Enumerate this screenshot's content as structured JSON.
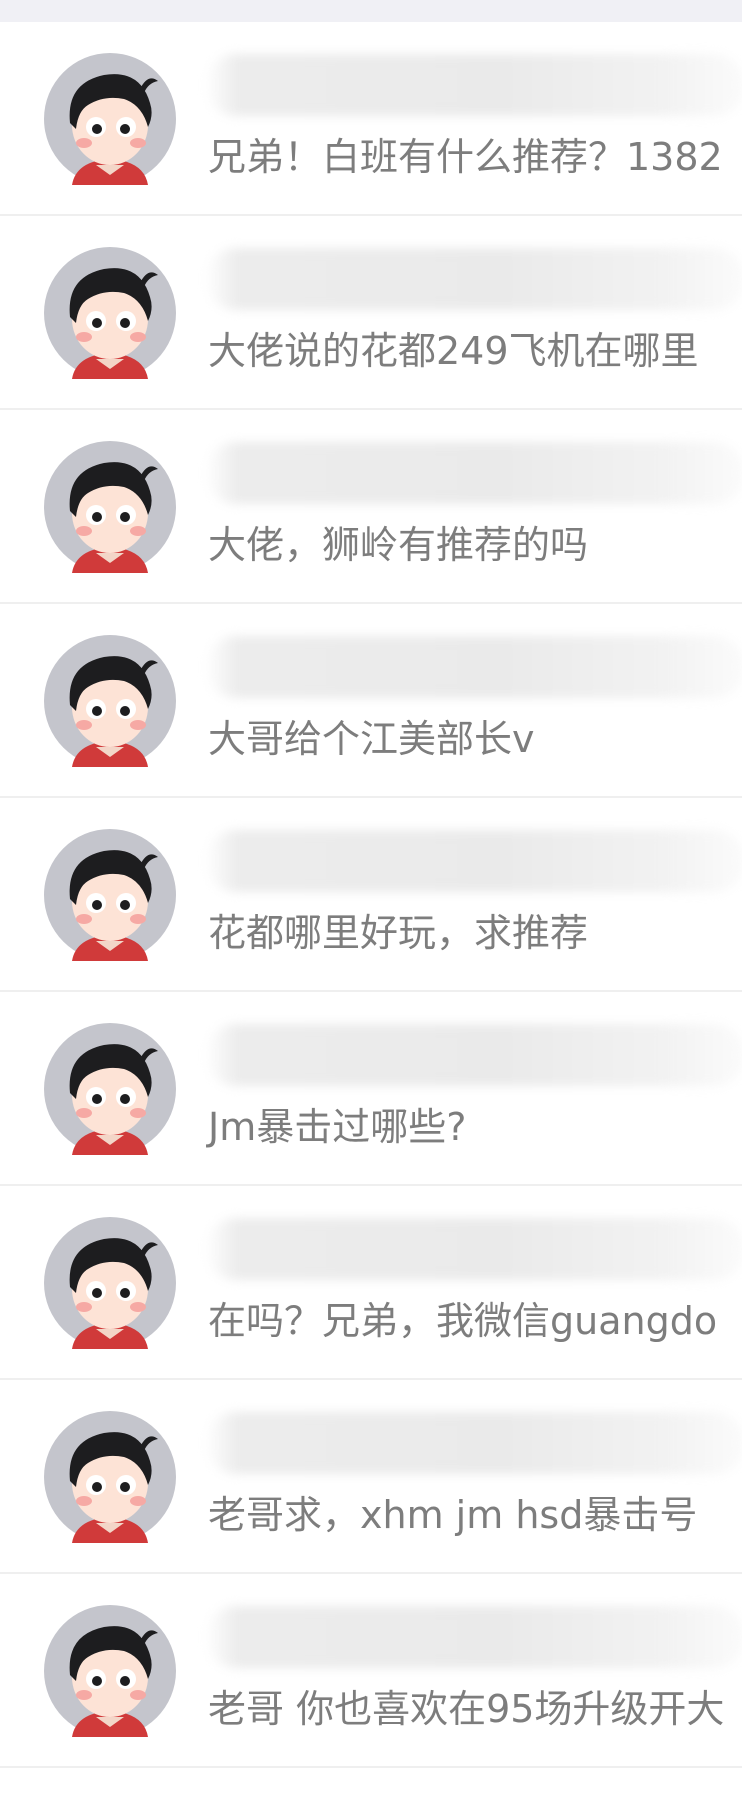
{
  "conversations": [
    {
      "preview": "兄弟！白班有什么推荐？1382"
    },
    {
      "preview": "大佬说的花都249飞机在哪里"
    },
    {
      "preview": "大佬，狮岭有推荐的吗"
    },
    {
      "preview": "大哥给个江美部长v"
    },
    {
      "preview": "花都哪里好玩，求推荐"
    },
    {
      "preview": "Jm暴击过哪些?"
    },
    {
      "preview": "在吗？兄弟，我微信guangdo"
    },
    {
      "preview": "老哥求，xhm jm hsd暴击号"
    },
    {
      "preview": "老哥 你也喜欢在95场升级开大"
    }
  ],
  "colors": {
    "page_background": "#ffffff",
    "preview_text": "#7d7d7d",
    "divider": "#efefef",
    "avatar_circle": "#c4c5cc"
  },
  "avatar_icon": "cartoon-boy-avatar"
}
